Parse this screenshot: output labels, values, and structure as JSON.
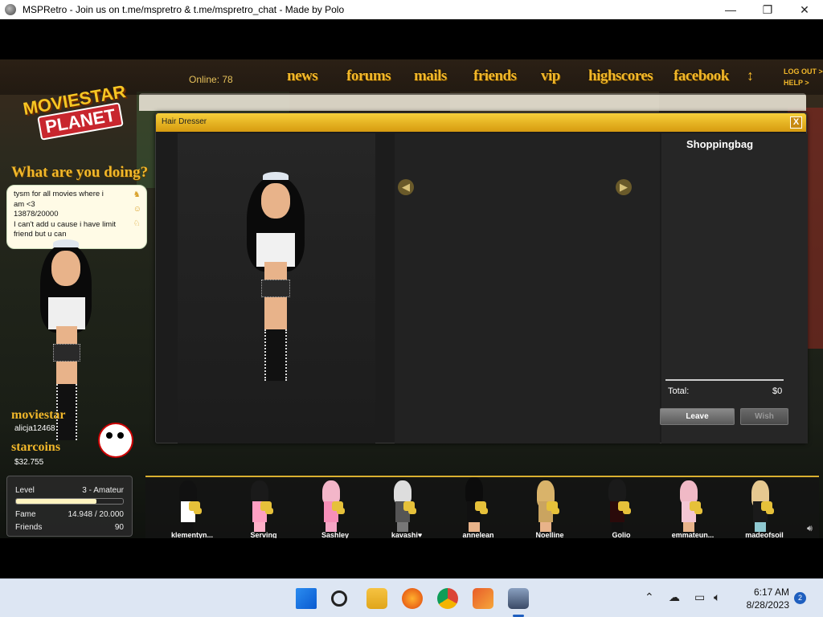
{
  "window": {
    "title": "MSPRetro - Join us on t.me/mspretro & t.me/mspretro_chat - Made by Polo",
    "minimize": "—",
    "maximize": "❐",
    "close": "✕"
  },
  "nav": {
    "online": "Online: 78",
    "items": [
      "news",
      "forums",
      "mails",
      "friends",
      "vip",
      "highscores",
      "facebook"
    ],
    "arrows": "↕",
    "logout": "LOG OUT >",
    "help": "HELP >"
  },
  "logo": {
    "line1": "MOVIESTAR",
    "line2": "PLANET"
  },
  "status": {
    "heading": "What are you doing?",
    "lines": [
      "tysm for all movies where i",
      "am <3",
      "13878/20000",
      "I can't add u cause i have limit",
      "friend but u can"
    ]
  },
  "profile": {
    "moviestar_label": "moviestar",
    "username": "alicja12468",
    "starcoins_label": "starcoins",
    "coins": "$32.755"
  },
  "stats": {
    "level_label": "Level",
    "level_value": "3 - Amateur",
    "level_progress": 0.75,
    "fame_label": "Fame",
    "fame_value": "14.948 / 20.000",
    "friends_label": "Friends",
    "friends_value": "90"
  },
  "dialog": {
    "title": "Hair Dresser",
    "close": "X",
    "shoppingbag": "Shoppingbag",
    "total_label": "Total:",
    "total_value": "$0",
    "leave": "Leave",
    "wish": "Wish"
  },
  "friends": [
    {
      "name": "klementyn..."
    },
    {
      "name": "Serving"
    },
    {
      "name": "Sashley"
    },
    {
      "name": "kavashi♥"
    },
    {
      "name": "annelean"
    },
    {
      "name": "Noelline"
    },
    {
      "name": "Golio"
    },
    {
      "name": "emmateun..."
    },
    {
      "name": "madeofsoil"
    }
  ],
  "taskbar": {
    "time": "6:17 AM",
    "date": "8/28/2023",
    "notifications": "2"
  },
  "colors": {
    "accent_gold": "#f1b72a",
    "dialog_header": "#f6cf3a"
  }
}
